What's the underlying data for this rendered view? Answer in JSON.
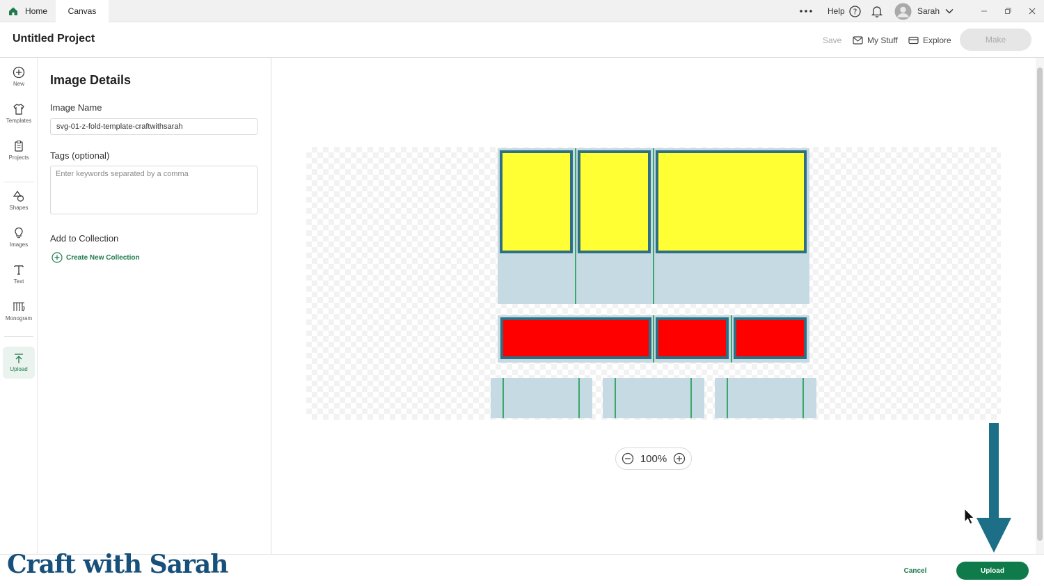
{
  "tabs": {
    "home": "Home",
    "canvas": "Canvas"
  },
  "topbar": {
    "help": "Help",
    "user": "Sarah"
  },
  "header": {
    "project_title": "Untitled Project",
    "save": "Save",
    "my_stuff": "My Stuff",
    "explore": "Explore",
    "make": "Make"
  },
  "rail": {
    "items": [
      "New",
      "Templates",
      "Projects",
      "Shapes",
      "Images",
      "Text",
      "Monogram",
      "Upload"
    ]
  },
  "panel": {
    "title": "Image Details",
    "image_name_label": "Image Name",
    "image_name_value": "svg-01-z-fold-template-craftwithsarah",
    "tags_label": "Tags (optional)",
    "tags_placeholder": "Enter keywords separated by a comma",
    "collection_label": "Add to Collection",
    "create_collection": "Create New Collection"
  },
  "canvas": {
    "zoom": "100%"
  },
  "footer": {
    "cancel": "Cancel",
    "upload": "Upload"
  },
  "watermark": "Craft with Sarah",
  "colors": {
    "accent_green": "#0f7a4a",
    "yellow_panel": "#ffff33",
    "red_panel": "#ff0000",
    "frame_teal": "#2e6f84",
    "base_blue": "#c5dae3",
    "arrow": "#1c6f86"
  }
}
